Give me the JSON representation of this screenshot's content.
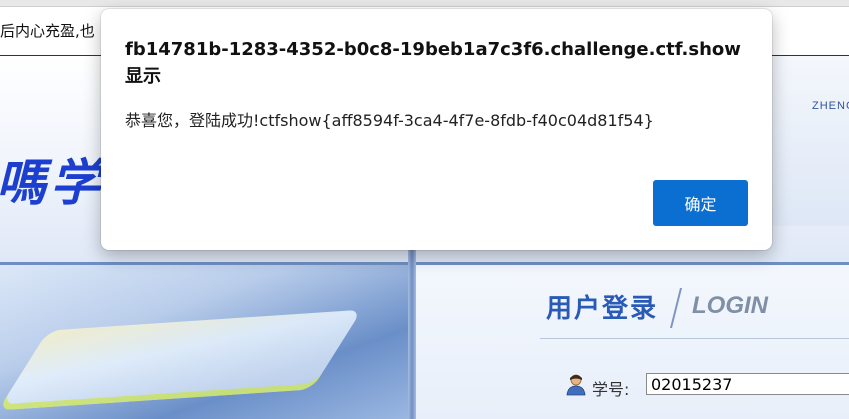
{
  "page": {
    "marquee_text": "后内心充盈,也",
    "banner_english": "ZHENG",
    "banner_calligraphy": "嗎学"
  },
  "login": {
    "title": "用户登录",
    "title_en": "LOGIN",
    "student_id_label": "学号:",
    "student_id_value": "02015237",
    "user_icon": "user-icon"
  },
  "dialog": {
    "title": "fb14781b-1283-4352-b0c8-19beb1a7c3f6.challenge.ctf.show 显示",
    "message": "恭喜您，登陆成功!ctfshow{aff8594f-3ca4-4f7e-8fdb-f40c04d81f54}",
    "ok_label": "确定"
  },
  "colors": {
    "accent": "#0a6fd0",
    "login_title": "#2a5ab7"
  }
}
